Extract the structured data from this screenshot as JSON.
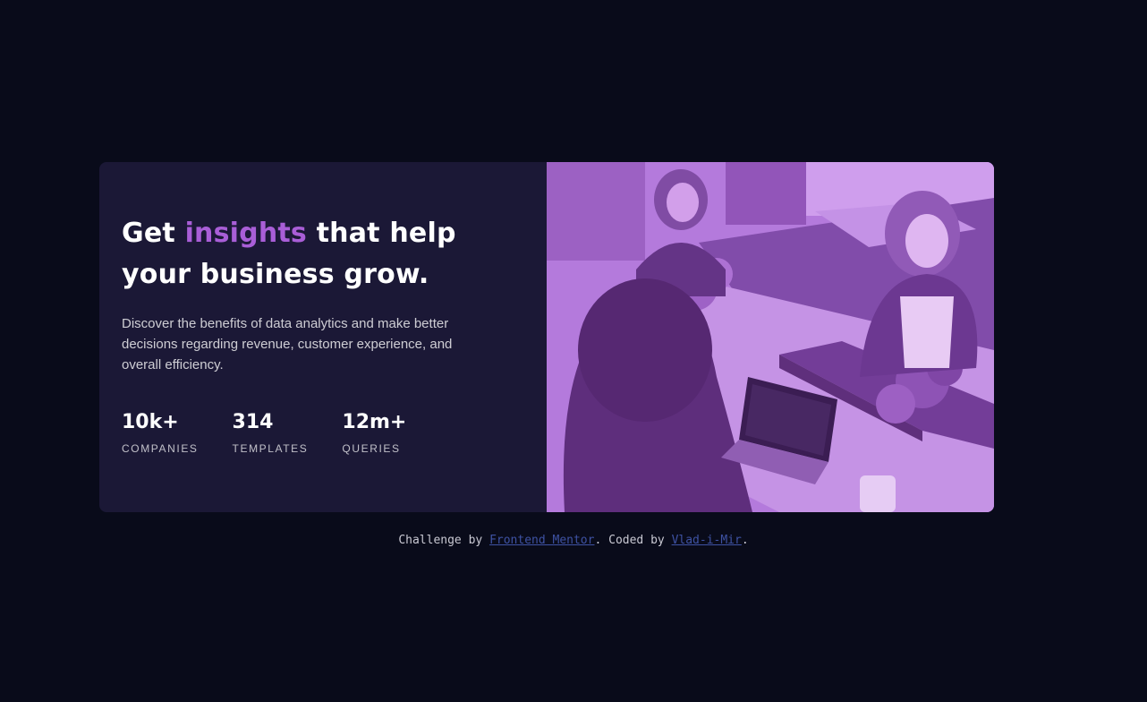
{
  "card": {
    "headline": {
      "before": "Get ",
      "accent": "insights",
      "after": " that help your business grow."
    },
    "description": "Discover the benefits of data analytics and make better decisions regarding revenue, customer experience, and overall efficiency.",
    "stats": [
      {
        "value": "10k+",
        "label": "Companies"
      },
      {
        "value": "314",
        "label": "Templates"
      },
      {
        "value": "12m+",
        "label": "Queries"
      }
    ]
  },
  "attribution": {
    "prefix": "Challenge by ",
    "link1": "Frontend Mentor",
    "middle": ". Coded by ",
    "link2": "Vlad-i-Mir",
    "suffix": "."
  },
  "colors": {
    "background": "#090b1a",
    "card": "#1b1836",
    "accent": "#a95ed7",
    "image_overlay": "#aa5cdb",
    "link": "#3e52a3"
  }
}
